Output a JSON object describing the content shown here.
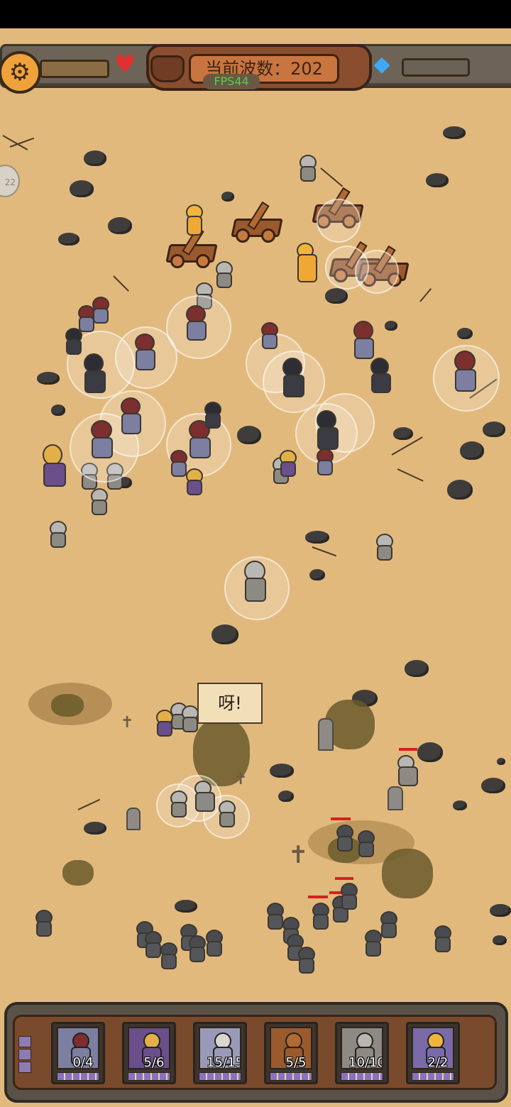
{
  "hud": {
    "wave_label": "当前波数：",
    "wave_number": "202",
    "fps": "FPS44",
    "settings_icon": "gear-icon",
    "health_icon": "heart-icon",
    "resource_icon": "crystal-icon",
    "side_button": "22"
  },
  "field": {
    "speech_text": "呀!"
  },
  "unit_cards": [
    {
      "count": "0/4",
      "portrait_color": "#7c7fa0",
      "head_color": "#7d2e2e"
    },
    {
      "count": "5/6",
      "portrait_color": "#6a4f8a",
      "head_color": "#e2b047"
    },
    {
      "count": "15/15",
      "portrait_color": "#9a9ab8",
      "head_color": "#d9d6cf"
    },
    {
      "count": "5/5",
      "portrait_color": "#9a5a2c",
      "head_color": "#b06a34"
    },
    {
      "count": "10/10",
      "portrait_color": "#8d8a84",
      "head_color": "#b9b7b1"
    },
    {
      "count": "2/2",
      "portrait_color": "#7a6aa8",
      "head_color": "#f1b53b"
    }
  ],
  "colors": {
    "sand": "#e2b97c",
    "wave_plate": "#8a4e2e",
    "fps": "#4cd44c",
    "heart": "#e23030",
    "crystal": "#3fa9f5"
  }
}
